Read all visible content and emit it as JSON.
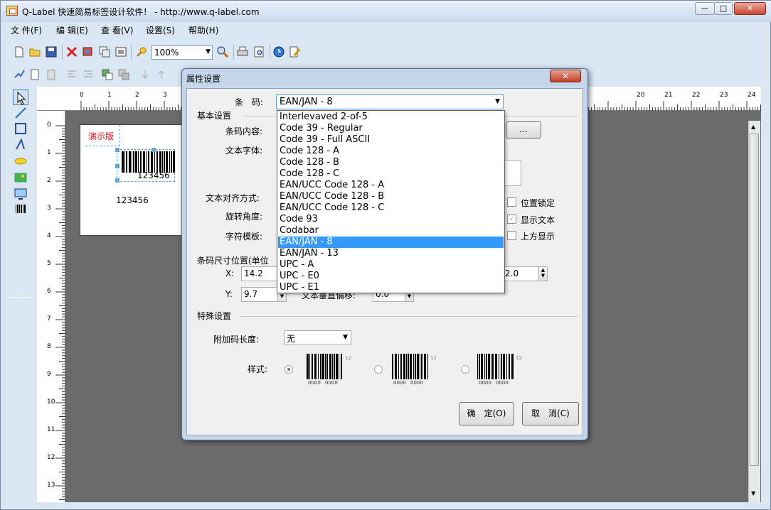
{
  "window": {
    "title": "Q-Label 快速简易标签设计软件！ - http://www.q-label.com",
    "min_glyph": "—",
    "max_glyph": "□",
    "close_glyph": "✕"
  },
  "menubar": [
    "文 件(F)",
    "编 辑(E)",
    "查 看(V)",
    "设置(S)",
    "帮助(H)"
  ],
  "toolbar": {
    "zoom": "100%",
    "icons": [
      "new-file-icon",
      "open-folder-icon",
      "save-icon",
      "delete-icon",
      "copy-icon",
      "paste-icon",
      "select-icon",
      "zoom-in-icon",
      "zoom-tool-icon",
      "print-icon",
      "print-preview-icon",
      "clock-icon",
      "edit-icon"
    ]
  },
  "rulers": {
    "top": [
      "0",
      "1",
      "2",
      "3",
      "20",
      "21",
      "22",
      "23",
      "24"
    ],
    "left": [
      "0",
      "1",
      "2",
      "3",
      "4",
      "5",
      "6",
      "7",
      "8",
      "9",
      "10",
      "11",
      "12",
      "13"
    ]
  },
  "canvas": {
    "demo_text": "演示版",
    "barcode_number": "123456",
    "text_object": "123456"
  },
  "dialog": {
    "title": "属性设置",
    "close_glyph": "✕",
    "barcode_label": "条　码:",
    "barcode_value": "EAN/JAN - 8",
    "basic_group": "基本设置",
    "content_label": "条码内容:",
    "font_label": "文本字体:",
    "align_label": "文本对齐方式:",
    "rotate_label": "旋转角度:",
    "template_label": "字符模板:",
    "browse_label": "...",
    "lock_label": "位置锁定",
    "show_text_label": "显示文本",
    "top_show_label": "上方显示",
    "size_group": "条码尺寸位置(单位",
    "x_label": "X:",
    "x_value": "14.2",
    "y_label": "Y:",
    "y_value": "9.7",
    "right_value": "2.0",
    "vert_offset_label": "文本垂直偏移:",
    "vert_offset_value": "0.0",
    "special_group": "特殊设置",
    "addon_label": "附加码长度:",
    "addon_value": "无",
    "style_label": "样式:",
    "style_digits": [
      "0000",
      "0000",
      "12"
    ],
    "ok_label": "确　定(O)",
    "cancel_label": "取　消(C)"
  },
  "code_options": [
    "Interlevaved 2-of-5",
    "Code 39 - Regular",
    "Code 39 - Full ASCII",
    "Code 128 - A",
    "Code 128 - B",
    "Code 128 - C",
    "EAN/UCC Code 128 - A",
    "EAN/UCC Code 128 - B",
    "EAN/UCC Code 128 - C",
    "Code 93",
    "Codabar",
    "EAN/JAN - 8",
    "EAN/JAN - 13",
    "UPC - A",
    "UPC - E0",
    "UPC - E1"
  ],
  "selected_option": "EAN/JAN - 8",
  "colors": {
    "accent": "#3399ff",
    "demo_text": "#e02020",
    "canvas_bg": "#6b6b6b"
  }
}
